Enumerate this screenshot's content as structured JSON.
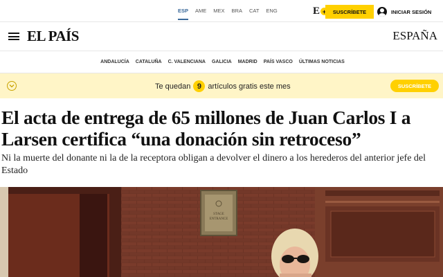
{
  "topbar": {
    "editions": [
      "ESP",
      "AME",
      "MEX",
      "BRA",
      "CAT",
      "ENG"
    ],
    "active_edition": "ESP",
    "eplus_letter": "E",
    "eplus_plus": "+",
    "subscribe_label": "SUSCRÍBETE",
    "login_label": "INICIAR SESIÓN"
  },
  "header": {
    "logo": "EL PAÍS",
    "section": "ESPAÑA"
  },
  "regions": [
    "ANDALUCÍA",
    "CATALUÑA",
    "C. VALENCIANA",
    "GALICIA",
    "MADRID",
    "PAÍS VASCO",
    "ÚLTIMAS NOTICIAS"
  ],
  "banner": {
    "prefix": "Te quedan",
    "count": "9",
    "suffix": "artículos gratis este mes",
    "subscribe_label": "SUSCRÍBETE"
  },
  "article": {
    "headline": "El acta de entrega de 65 millones de Juan Carlos I a Larsen certifica “una donación sin retroceso”",
    "subheadline": "Ni la muerte del donante ni la de la receptora obligan a devolver el dinero a los herederos del anterior jefe del Estado",
    "photo_sign": [
      "STAGE",
      "ENTRANCE"
    ]
  },
  "colors": {
    "accent_yellow": "#ffd000",
    "banner_bg": "#fff5c7",
    "edition_active": "#3b6a9a"
  }
}
